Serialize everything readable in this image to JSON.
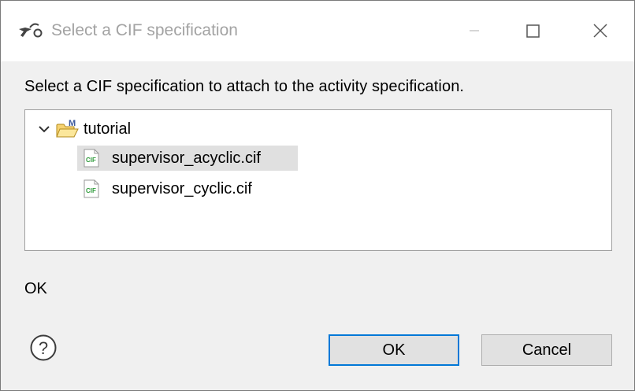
{
  "window": {
    "title": "Select a CIF specification",
    "controls": [
      "minimize-icon",
      "maximize-icon",
      "close-icon"
    ]
  },
  "prompt": "Select a CIF specification to attach to the activity specification.",
  "tree": {
    "root": {
      "label": "tutorial",
      "expanded": true,
      "icon": "project-folder-icon"
    },
    "children": [
      {
        "label": "supervisor_acyclic.cif",
        "selected": true,
        "icon": "cif-file-icon"
      },
      {
        "label": "supervisor_cyclic.cif",
        "selected": false,
        "icon": "cif-file-icon"
      }
    ]
  },
  "status": "OK",
  "buttons": {
    "ok": "OK",
    "cancel": "Cancel"
  },
  "colors": {
    "accent": "#0078d7",
    "selection": "#e0e0e0",
    "cif_green": "#2e9a3a"
  }
}
